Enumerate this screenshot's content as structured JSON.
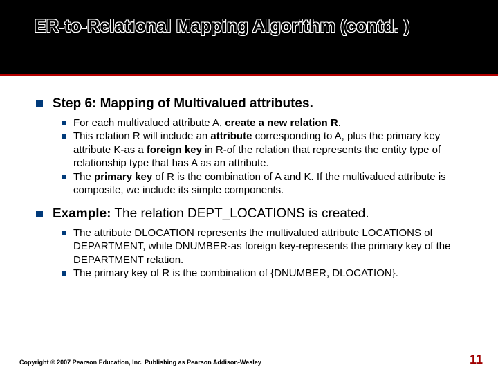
{
  "title": "ER-to-Relational Mapping Algorithm (contd. )",
  "step6": {
    "heading": "Step 6: Mapping of Multivalued attributes.",
    "b1_pre": "For each multivalued attribute A, ",
    "b1_bold": "create a new relation R",
    "b1_post": ".",
    "b2_pre": "This relation R will include an ",
    "b2_bold1": "attribute",
    "b2_mid": " corresponding to A, plus the primary key attribute K-as a ",
    "b2_bold2": "foreign key",
    "b2_post": " in R-of the relation that represents the entity type of relationship type that has A as an attribute.",
    "b3_pre": "The ",
    "b3_bold": "primary key",
    "b3_post": " of R is the combination of A and K. If the multivalued attribute is composite, we include its simple components."
  },
  "example": {
    "label": "Example:",
    "text": " The relation DEPT_LOCATIONS is created.",
    "b1": "The attribute DLOCATION represents the multivalued attribute LOCATIONS of DEPARTMENT, while DNUMBER-as foreign key-represents the primary key of the DEPARTMENT relation.",
    "b2": "The primary key of R is the combination of {DNUMBER, DLOCATION}."
  },
  "footer": "Copyright © 2007 Pearson Education, Inc. Publishing as Pearson Addison-Wesley",
  "page": "11"
}
